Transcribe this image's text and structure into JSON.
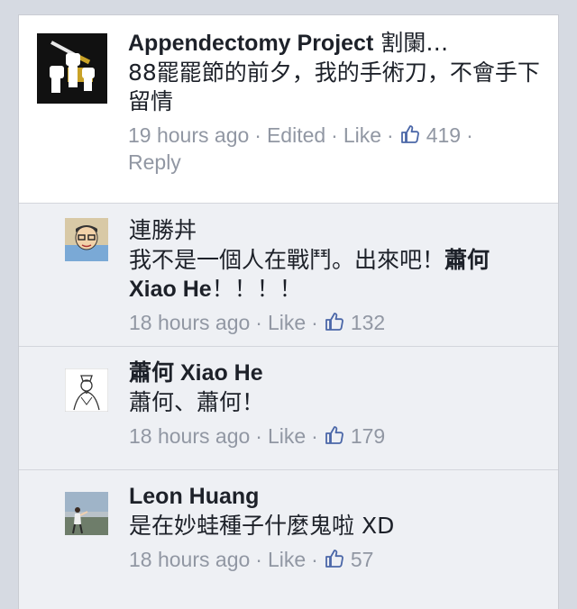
{
  "comments": [
    {
      "author": "Appendectomy Project",
      "author_suffix": "割闌…",
      "text": "88罷罷節的前夕，我的手術刀，不會手下留情",
      "time": "19 hours ago",
      "edited": "Edited",
      "like": "Like",
      "like_count": "419",
      "reply": "Reply",
      "avatar_icon": "fists-scalpel-logo-icon"
    },
    {
      "author": "連勝丼",
      "text_before": "我不是一個人在戰鬥。出來吧！",
      "mention": "蕭何 Xiao He",
      "text_after": "！！！！",
      "time": "18 hours ago",
      "like": "Like",
      "like_count": "132",
      "avatar_icon": "cartoon-face-avatar-icon"
    },
    {
      "author": "蕭何 Xiao He",
      "text": "蕭何、蕭何！",
      "time": "18 hours ago",
      "like": "Like",
      "like_count": "179",
      "avatar_icon": "ink-sketch-avatar-icon"
    },
    {
      "author": "Leon Huang",
      "text": "是在妙蛙種子什麼鬼啦 XD",
      "time": "18 hours ago",
      "like": "Like",
      "like_count": "57",
      "avatar_icon": "photo-avatar-icon"
    }
  ],
  "colors": {
    "text": "#1d2129",
    "meta": "#9197a3",
    "thumb": "#4b67a8",
    "reply_bg": "#eef0f4",
    "main_bg": "#ffffff"
  }
}
